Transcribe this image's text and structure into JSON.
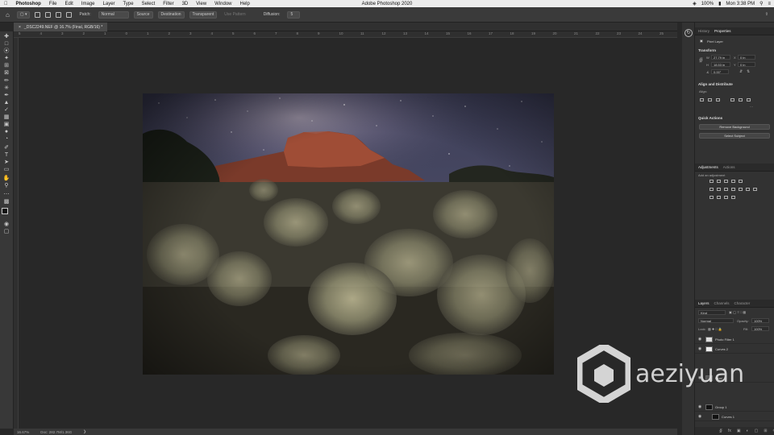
{
  "menubar": {
    "app": "Photoshop",
    "items": [
      "File",
      "Edit",
      "Image",
      "Layer",
      "Type",
      "Select",
      "Filter",
      "3D",
      "View",
      "Window",
      "Help"
    ],
    "title": "Adobe Photoshop 2020",
    "battery": "100%",
    "clock": "Mon 3:38 PM"
  },
  "options": {
    "patch_label": "Patch:",
    "patch_mode": "Normal",
    "source_btn": "Source",
    "destination_btn": "Destination",
    "transparent": "Transparent",
    "use_pattern": "Use Pattern",
    "diffusion_label": "Diffusion:",
    "diffusion_value": "5"
  },
  "document": {
    "tab_title": "_DSC2249.NEF @ 16.7% (Final, RGB/16) *",
    "ruler_numbers": [
      "5",
      "4",
      "3",
      "2",
      "1",
      "0",
      "1",
      "2",
      "3",
      "4",
      "5",
      "6",
      "7",
      "8",
      "9",
      "10",
      "11",
      "12",
      "13",
      "14",
      "15",
      "16",
      "17",
      "18",
      "19",
      "20",
      "21",
      "22",
      "23",
      "24",
      "25"
    ],
    "zoom": "16.67%",
    "doc_size": "Doc: 282.7M/1.36G"
  },
  "panels": {
    "top_tabs": [
      "History",
      "Properties"
    ],
    "properties": {
      "kind": "Pixel Layer",
      "transform_title": "Transform",
      "w": "27.79 in",
      "h": "18.53 in",
      "x": "0 in",
      "y": "0 in",
      "angle": "0.00°",
      "align_title": "Align and Distribute",
      "align_label": "Align:",
      "quick_title": "Quick Actions",
      "remove_bg": "Remove Background",
      "select_subject": "Select Subject"
    },
    "adjust_tabs": [
      "Adjustments",
      "Actions"
    ],
    "add_adjustment": "Add an adjustment",
    "layer_tabs": [
      "Layers",
      "Channels",
      "Character"
    ],
    "layers": {
      "kind_filter": "Kind",
      "blend_mode": "Normal",
      "opacity_label": "Opacity:",
      "opacity_value": "100%",
      "lock_label": "Lock:",
      "fill_label": "Fill:",
      "fill_value": "100%",
      "rows": [
        "Photo Filter 1",
        "Curves 2",
        "Final",
        "Group 1",
        "Curves 1"
      ]
    }
  },
  "watermark": "aeziyuan",
  "colors": {
    "menubar": "#ececec",
    "app_chrome": "#383838",
    "canvas_bg": "#282828",
    "panel_bg": "#323232"
  }
}
